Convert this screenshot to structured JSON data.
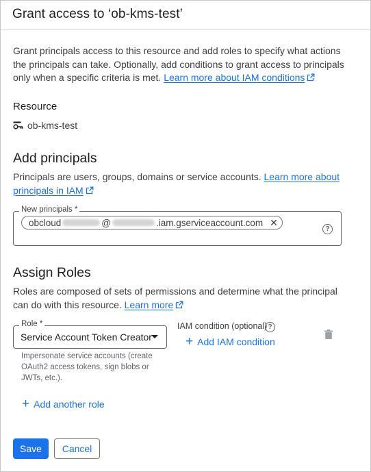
{
  "dialog": {
    "title": "Grant access to ‘ob-kms-test’",
    "intro_text": "Grant principals access to this resource and add roles to specify what actions the principals can take. Optionally, add conditions to grant access to principals only when a specific criteria is met.",
    "intro_link": "Learn more about IAM conditions"
  },
  "resource": {
    "heading": "Resource",
    "name": "ob-kms-test",
    "icon": "key-ring-icon"
  },
  "principals": {
    "heading": "Add principals",
    "description": "Principals are users, groups, domains or service accounts.",
    "link": "Learn more about principals in IAM",
    "field_label": "New principals *",
    "chip": {
      "prefix": "obcloud",
      "at": "@",
      "suffix": ".iam.gserviceaccount.com"
    }
  },
  "roles": {
    "heading": "Assign Roles",
    "description": "Roles are composed of sets of permissions and determine what the principal can do with this resource.",
    "link": "Learn more",
    "role_label": "Role *",
    "role_value": "Service Account Token Creator",
    "role_description": "Impersonate service accounts (create OAuth2 access tokens, sign blobs or JWTs, etc.).",
    "iam_condition_label": "IAM condition (optional)",
    "add_condition": "Add IAM condition",
    "add_role": "Add another role"
  },
  "actions": {
    "save": "Save",
    "cancel": "Cancel"
  },
  "colors": {
    "accent": "#1a73e8",
    "text": "#202124",
    "muted": "#5f6368"
  }
}
